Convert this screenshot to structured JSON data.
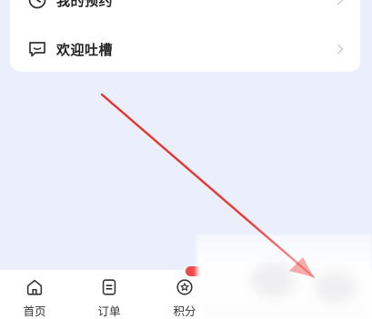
{
  "menu": {
    "items": [
      {
        "label": "我的预约",
        "icon": "clock-icon"
      },
      {
        "label": "欢迎吐槽",
        "icon": "chat-icon"
      }
    ]
  },
  "tabbar": {
    "tabs": [
      {
        "label": "首页",
        "icon": "home-icon"
      },
      {
        "label": "订单",
        "icon": "order-icon"
      },
      {
        "label": "积分",
        "icon": "points-icon"
      }
    ],
    "points_badge": ""
  },
  "colors": {
    "page_bg": "#eaeffb",
    "card_bg": "#ffffff",
    "arrow": "#e8322d",
    "badge": "#ee4a4a"
  }
}
